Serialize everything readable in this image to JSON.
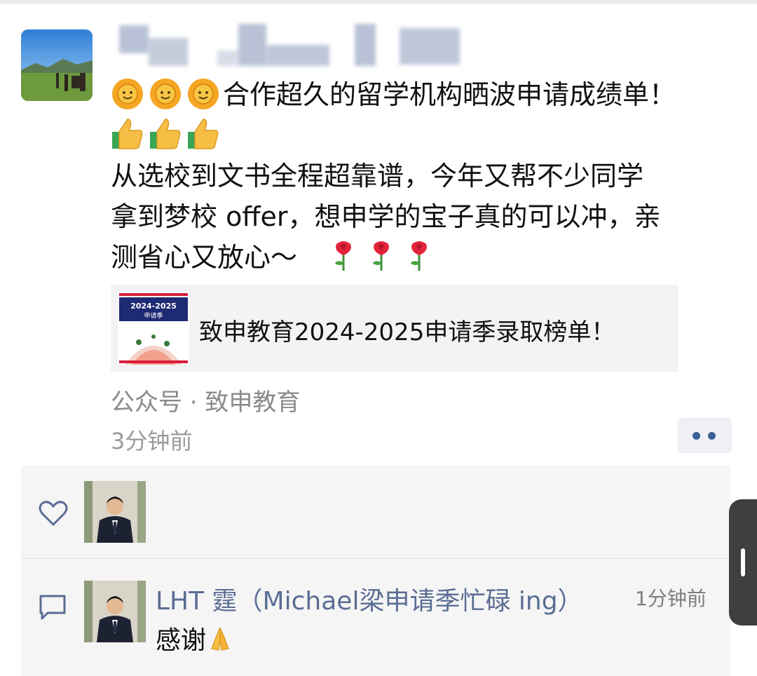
{
  "post": {
    "author_name": "",
    "line1": "合作超久的留学机构晒波申请成绩单！",
    "line3": "从选校到文书全程超靠谱，今年又帮不少同学",
    "line4": "拿到梦校 offer，想申学的宝子真的可以冲，亲",
    "line5": "测省心又放心～",
    "line1_emojis": [
      "sun-emoji",
      "sun-emoji",
      "sun-emoji"
    ],
    "line2_emojis": [
      "thumbs-up-emoji",
      "thumbs-up-emoji",
      "thumbs-up-emoji"
    ],
    "line5_emojis": [
      "rose-emoji",
      "rose-emoji",
      "rose-emoji"
    ],
    "share": {
      "thumb_title": "2024-2025",
      "thumb_subtitle": "申请季",
      "title": "致申教育2024-2025申请季录取榜单！"
    },
    "source": "公众号 · 致申教育",
    "time": "3分钟前"
  },
  "interactions": {
    "comment": {
      "name": "LHT 霆（Michael梁申请季忙碌 ing）",
      "time": "1分钟前",
      "text": "感谢"
    }
  },
  "colors": {
    "link_name": "#5a6d94",
    "meta_gray": "#8a8a8a",
    "panel_bg": "#f5f5f5",
    "more_dots": "#3d5f92"
  }
}
